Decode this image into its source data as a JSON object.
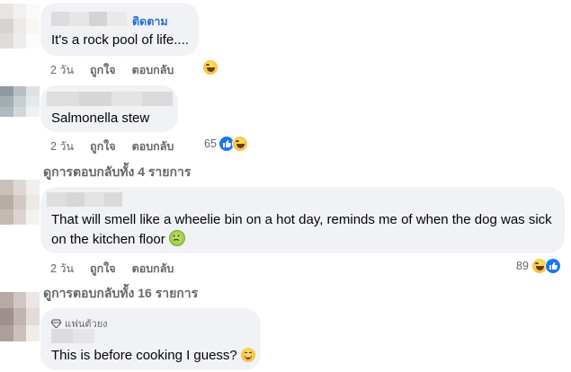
{
  "comments": [
    {
      "follow_label": "ติดตาม",
      "text": "It's a rock pool of life....",
      "time": "2 วัน",
      "like_label": "ถูกใจ",
      "reply_label": "ตอบกลับ"
    },
    {
      "text": "Salmonella stew",
      "time": "2 วัน",
      "like_label": "ถูกใจ",
      "reply_label": "ตอบกลับ",
      "reaction_count": "65",
      "view_replies": "ดูการตอบกลับทั้ง 4 รายการ"
    },
    {
      "text": "That will smell like a wheelie bin on a hot day, reminds me of when the dog was sick on the kitchen floor",
      "time": "2 วัน",
      "like_label": "ถูกใจ",
      "reply_label": "ตอบกลับ",
      "reaction_count": "89",
      "view_replies": "ดูการตอบกลับทั้ง 16 รายการ"
    },
    {
      "badge": "แฟนตัวยง",
      "text": "This is before cooking I guess?"
    }
  ],
  "icons": {
    "laugh": "laughing-emoji",
    "like": "thumbs-up",
    "sick": "nauseated-face",
    "smile": "grinning-face",
    "diamond": "diamond-icon"
  },
  "colors": {
    "bubble": "#f0f2f5",
    "link": "#216fdb",
    "meta": "#65676b",
    "like_blue": "#1877f2"
  }
}
